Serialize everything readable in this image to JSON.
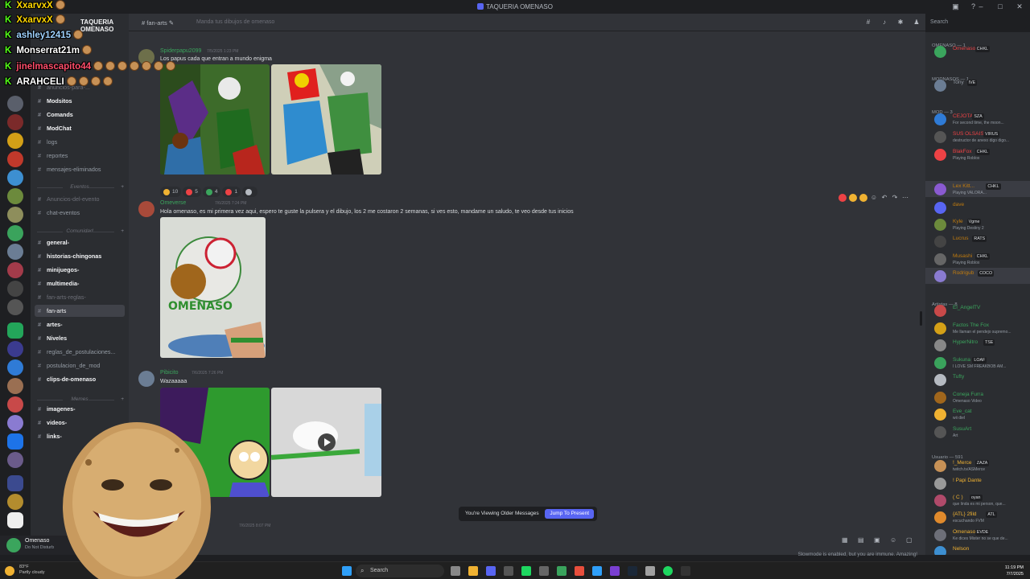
{
  "window": {
    "title": "TAQUERIA OMENASO"
  },
  "server": {
    "name": "TAQUERIA OMENASO"
  },
  "channel": {
    "name": "fan-arts",
    "topic": "Manda tus dibujos de omenaso"
  },
  "search": {
    "placeholder": "Search"
  },
  "sidebar": {
    "channels": [
      {
        "label": "anuncios-para-...",
        "style": "dim"
      },
      {
        "label": "Modsitos",
        "style": "bold"
      },
      {
        "label": "Comands",
        "style": "bold"
      },
      {
        "label": "ModChat",
        "style": "bold"
      },
      {
        "label": "logs",
        "style": "normal"
      },
      {
        "label": "reportes",
        "style": "normal"
      },
      {
        "label": "mensajes-eliminados",
        "style": "normal"
      },
      {
        "label": "Anuncios-del-evento",
        "style": "dim"
      },
      {
        "label": "chat-eventos",
        "style": "normal"
      },
      {
        "label": "general-",
        "style": "bold"
      },
      {
        "label": "historias-chingonas",
        "style": "bold"
      },
      {
        "label": "minijuegos-",
        "style": "bold"
      },
      {
        "label": "multimedia-",
        "style": "bold"
      },
      {
        "label": "fan-arts-reglas-",
        "style": "dim"
      },
      {
        "label": "fan-arts",
        "style": "sel"
      },
      {
        "label": "artes-",
        "style": "bold"
      },
      {
        "label": "Niveles",
        "style": "bold"
      },
      {
        "label": "reglas_de_postulaciones...",
        "style": "normal"
      },
      {
        "label": "postulacion_de_mod",
        "style": "normal"
      },
      {
        "label": "clips-de-omenaso",
        "style": "bold"
      },
      {
        "label": "imagenes-",
        "style": "bold"
      },
      {
        "label": "videos-",
        "style": "bold"
      },
      {
        "label": "links-",
        "style": "bold"
      }
    ],
    "categories": [
      "Eventos",
      "Comunidad",
      "Memes"
    ],
    "user": {
      "name": "Omenaso",
      "status": "Do Not Disturb"
    }
  },
  "messages": [
    {
      "author": "Spiderpapu2099",
      "time": "7/5/2025 1:23 PM",
      "text": "Los papus cada que entran a mundo enigma",
      "author_color": "#3ba55d"
    },
    {
      "author": "Omeverse",
      "time": "7/6/2025 7:24 PM",
      "text": "Hola omenaso, es mi primera vez aqui, espero te guste la pulsera y el dibujo, los 2 me costaron 2 semanas, si ves esto, mandame un saludo, te veo desde tus inicios",
      "author_color": "#3ba55d"
    },
    {
      "author": "Pibicito",
      "time": "7/6/2025 7:26 PM",
      "text": "Wazaaaaa",
      "author_color": "#3ba55d"
    },
    {
      "author": "",
      "time": "7/6/2025 8:07 PM",
      "text": "",
      "author_color": "#3ba55d"
    }
  ],
  "reactions": [
    {
      "count": "10",
      "color": "#f0b232"
    },
    {
      "count": "5",
      "color": "#ed4245"
    },
    {
      "count": "4",
      "color": "#3ba55d"
    },
    {
      "count": "1",
      "color": "#ed4245"
    },
    {
      "count": "",
      "color": "#b5bac1"
    }
  ],
  "banner": {
    "text": "You're Viewing Older Messages",
    "button": "Jump To Present"
  },
  "slowmode": {
    "text": "Slowmode is enabled, but you are immune. Amazing!"
  },
  "members": {
    "categories": [
      {
        "label": "OMENASO — 1"
      },
      {
        "label": "MODNASOS — 1"
      },
      {
        "label": "MOD — 3"
      },
      {
        "label": "moreamigos — 6"
      },
      {
        "label": "Artistas — 8"
      },
      {
        "label": "Usuario — 591"
      }
    ],
    "list": [
      {
        "name": "Omenaso",
        "tag": "CHKL",
        "status": "",
        "color": "#ed4245"
      },
      {
        "name": "Tony",
        "tag": "IVE",
        "status": "",
        "color": "#949ba4"
      },
      {
        "name": "CEJOTA",
        "tag": "SZA",
        "status": "For second time, the moon...",
        "color": "#ed4245"
      },
      {
        "name": "SUS OLSAIS",
        "tag": "VIRUS",
        "status": "destructor de anexo digo digo...",
        "color": "#ed4245"
      },
      {
        "name": "BlakFox",
        "tag": "CHKL",
        "status": "Playing Roblox",
        "color": "#ed4245"
      },
      {
        "name": "Lex Kitt...",
        "tag": "CHKL",
        "status": "Playing VALORA...",
        "color": "#c27c0e"
      },
      {
        "name": "dave",
        "tag": "",
        "status": "",
        "color": "#c27c0e"
      },
      {
        "name": "Kyle",
        "tag": "Vgme",
        "status": "Playing Destiny 2",
        "color": "#c27c0e"
      },
      {
        "name": "Lucrus",
        "tag": "RATS",
        "status": "",
        "color": "#c27c0e"
      },
      {
        "name": "Musashi",
        "tag": "CHKL",
        "status": "Playing Roblox",
        "color": "#c27c0e"
      },
      {
        "name": "Rodrigub",
        "tag": "COCO",
        "status": "",
        "color": "#c27c0e"
      },
      {
        "name": "El_AngelTV",
        "tag": "",
        "status": "",
        "color": "#3ba55d"
      },
      {
        "name": "Factos The Fox",
        "tag": "",
        "status": "Me llaman el pendejo supremo...",
        "color": "#3ba55d"
      },
      {
        "name": "HyperNitro",
        "tag": "TSE",
        "status": "",
        "color": "#3ba55d"
      },
      {
        "name": "Sukuna",
        "tag": "LOAF",
        "status": "I LOVE SM FREAKBOB AM...",
        "color": "#3ba55d"
      },
      {
        "name": "Tufty",
        "tag": "",
        "status": "",
        "color": "#3ba55d"
      },
      {
        "name": "Coneja Furra",
        "tag": "",
        "status": "Omenaso Video",
        "color": "#3ba55d"
      },
      {
        "name": "Eve_cat",
        "tag": "",
        "status": "wii dieI",
        "color": "#3ba55d"
      },
      {
        "name": "SusuArt",
        "tag": "",
        "status": "Art",
        "color": "#3ba55d"
      },
      {
        "name": "!_Merce",
        "tag": "ZAZA",
        "status": "twitch.tv/ASMerce",
        "color": "#f0b232"
      },
      {
        "name": "! Papi Dante",
        "tag": "",
        "status": "",
        "color": "#f0b232"
      },
      {
        "name": "( C )",
        "tag": "oyan",
        "status": "que linda es mi person, que...",
        "color": "#f0b232"
      },
      {
        "name": "{ATL} 2fild",
        "tag": "ATL",
        "status": "escuchando FVM",
        "color": "#f0b232"
      },
      {
        "name": "Omenaso",
        "tag": "EVDE",
        "status": "Ke dices Mister no se que de...",
        "color": "#f0b232"
      },
      {
        "name": "Nelson",
        "tag": "",
        "status": "",
        "color": "#f0b232"
      }
    ]
  },
  "overlay_chat": [
    {
      "name": "XxarvxX",
      "color": "#ffd700"
    },
    {
      "name": "XxarvxX",
      "color": "#ffd700"
    },
    {
      "name": "ashley12415",
      "color": "#9fd2ff"
    },
    {
      "name": "Monserrat21m",
      "color": "#ffffff"
    },
    {
      "name": "jinelmascapito44",
      "color": "#ff4d6a"
    },
    {
      "name": "ARAHCELI",
      "color": "#ffffff"
    }
  ],
  "taskbar": {
    "search": "Search",
    "weather_temp": "83°F",
    "weather_desc": "Partly cloudy",
    "time": "11:19 PM",
    "date": "7/7/2025"
  }
}
